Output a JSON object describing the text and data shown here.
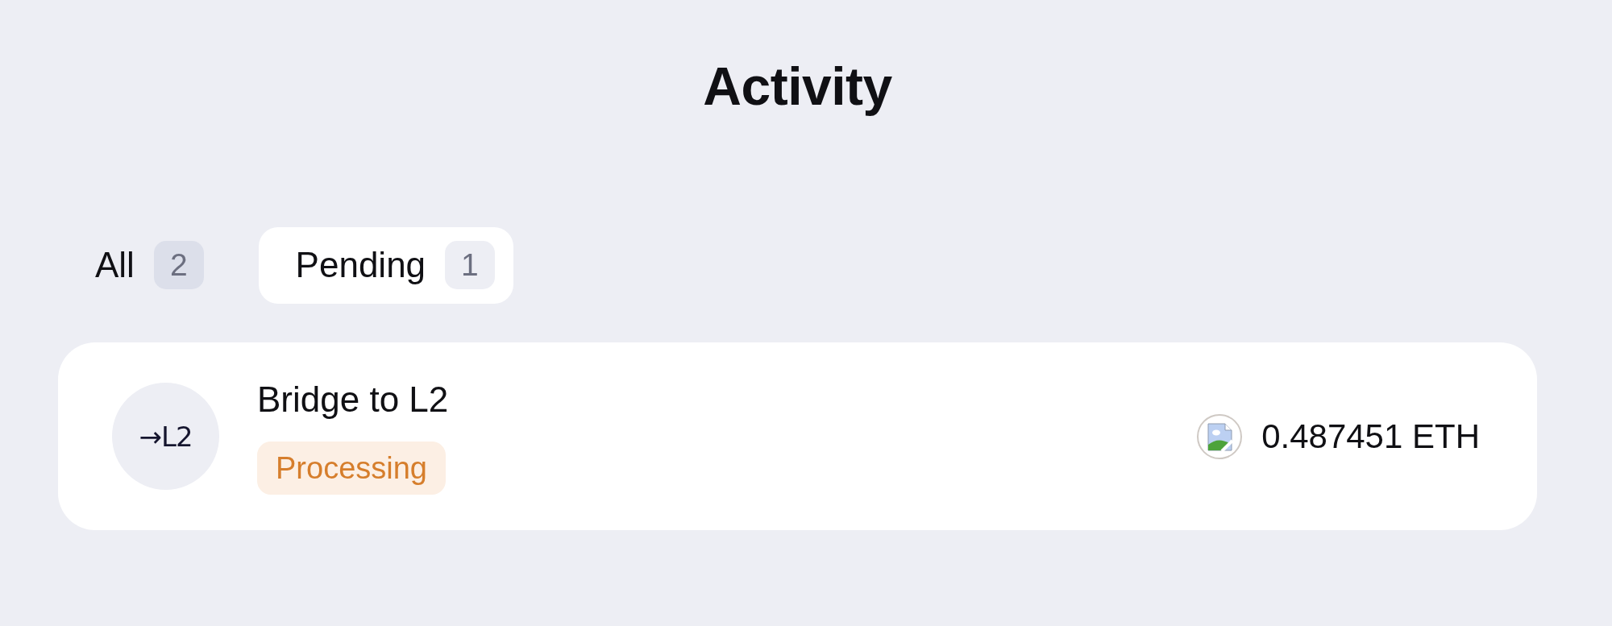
{
  "page": {
    "title": "Activity"
  },
  "tabs": [
    {
      "label": "All",
      "count": "2",
      "selected": false
    },
    {
      "label": "Pending",
      "count": "1",
      "selected": true
    }
  ],
  "transactions": [
    {
      "avatar_text": "→L2",
      "title": "Bridge to L2",
      "status": {
        "label": "Processing",
        "kind": "processing"
      },
      "amount": "0.487451 ETH"
    }
  ]
}
